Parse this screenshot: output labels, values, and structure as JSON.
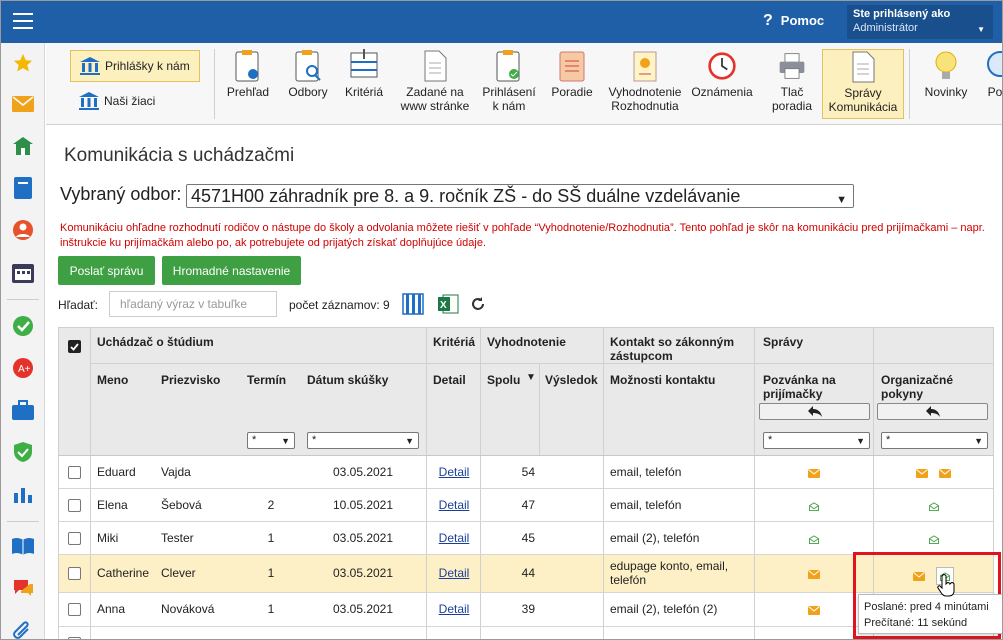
{
  "header": {
    "help_label": "Pomoc",
    "user_line1": "Ste prihlásený ako",
    "user_line2": "Administrátor"
  },
  "toolbar": {
    "left": [
      {
        "label": "Prihlášky k nám",
        "active": true
      },
      {
        "label": "Naši žiaci",
        "active": false
      }
    ],
    "buttons": [
      {
        "label": "Prehľad"
      },
      {
        "label": "Odbory"
      },
      {
        "label": "Kritériá"
      },
      {
        "label": "Zadané na www stránke"
      },
      {
        "label": "Prihlásení k nám"
      },
      {
        "label": "Poradie"
      },
      {
        "label": "Vyhodnotenie Rozhodnutia"
      },
      {
        "label": "Oznámenia"
      },
      {
        "label": "Tlač poradia"
      },
      {
        "label": "Správy Komunikácia"
      },
      {
        "label": "Novinky"
      },
      {
        "label": "Po"
      }
    ]
  },
  "page": {
    "title": "Komunikácia s uchádzačmi",
    "odbor_label": "Vybraný odbor:",
    "odbor_value": "4571H00 záhradník pre 8. a 9. ročník ZŠ - do SŠ duálne vzdelávanie",
    "notice": "Komunikáciu ohľadne rozhodnutí rodičov o nástupe do školy a odvolania môžete riešiť v pohľade “Vyhodnotenie/Rozhodnutia”. Tento pohľad je skôr na komunikáciu pred prijímačkami – napr. inštrukcie ku prijímačkám alebo po, ak potrebujete od prijatých získať doplňujúce údaje.",
    "send_button": "Poslať správu",
    "bulk_button": "Hromadné nastavenie",
    "search_label": "Hľadať:",
    "search_placeholder": "hľadaný výraz v tabuľke",
    "count_label": "počet záznamov: 9"
  },
  "table": {
    "group_headers": {
      "applicant": "Uchádzač o štúdium",
      "criteria": "Kritériá",
      "evaluation": "Vyhodnotenie",
      "contact": "Kontakt so zákonným zástupcom",
      "messages": "Správy"
    },
    "columns": {
      "name": "Meno",
      "surname": "Priezvisko",
      "term": "Termín",
      "exam_date": "Dátum skúšky",
      "detail": "Detail",
      "total": "Spolu",
      "result": "Výsledok",
      "contact_options": "Možnosti kontaktu",
      "invitation": "Pozvánka na prijímačky",
      "instructions": "Organizačné pokyny"
    },
    "filter_value": "*",
    "rows": [
      {
        "name": "Eduard",
        "surname": "Vajda",
        "term": "",
        "date": "03.05.2021",
        "detail": "Detail",
        "total": "54",
        "contact": "email, telefón",
        "inv": "sent",
        "org": "sent2"
      },
      {
        "name": "Elena",
        "surname": "Šebová",
        "term": "2",
        "date": "10.05.2021",
        "detail": "Detail",
        "total": "47",
        "contact": "email, telefón",
        "inv": "read",
        "org": "read"
      },
      {
        "name": "Miki",
        "surname": "Tester",
        "term": "1",
        "date": "03.05.2021",
        "detail": "Detail",
        "total": "45",
        "contact": "email (2), telefón",
        "inv": "read",
        "org": "read"
      },
      {
        "name": "Catherine",
        "surname": "Clever",
        "term": "1",
        "date": "03.05.2021",
        "detail": "Detail",
        "total": "44",
        "contact": "edupage konto, email, telefón",
        "inv": "sent",
        "org": "sent-read"
      },
      {
        "name": "Anna",
        "surname": "Nováková",
        "term": "1",
        "date": "03.05.2021",
        "detail": "Detail",
        "total": "39",
        "contact": "email (2), telefón (2)",
        "inv": "sent",
        "org": ""
      }
    ]
  },
  "tooltip": {
    "line1": "Poslané: pred 4 minútami",
    "line2": "Prečítané: 11 sekúnd"
  },
  "colors": {
    "topbar": "#1f5fa8",
    "green": "#3fa043",
    "highlight": "#fdf0c6",
    "mail_orange": "#f0a21b",
    "read_green": "#3fa043",
    "red_frame": "#e0141e"
  }
}
